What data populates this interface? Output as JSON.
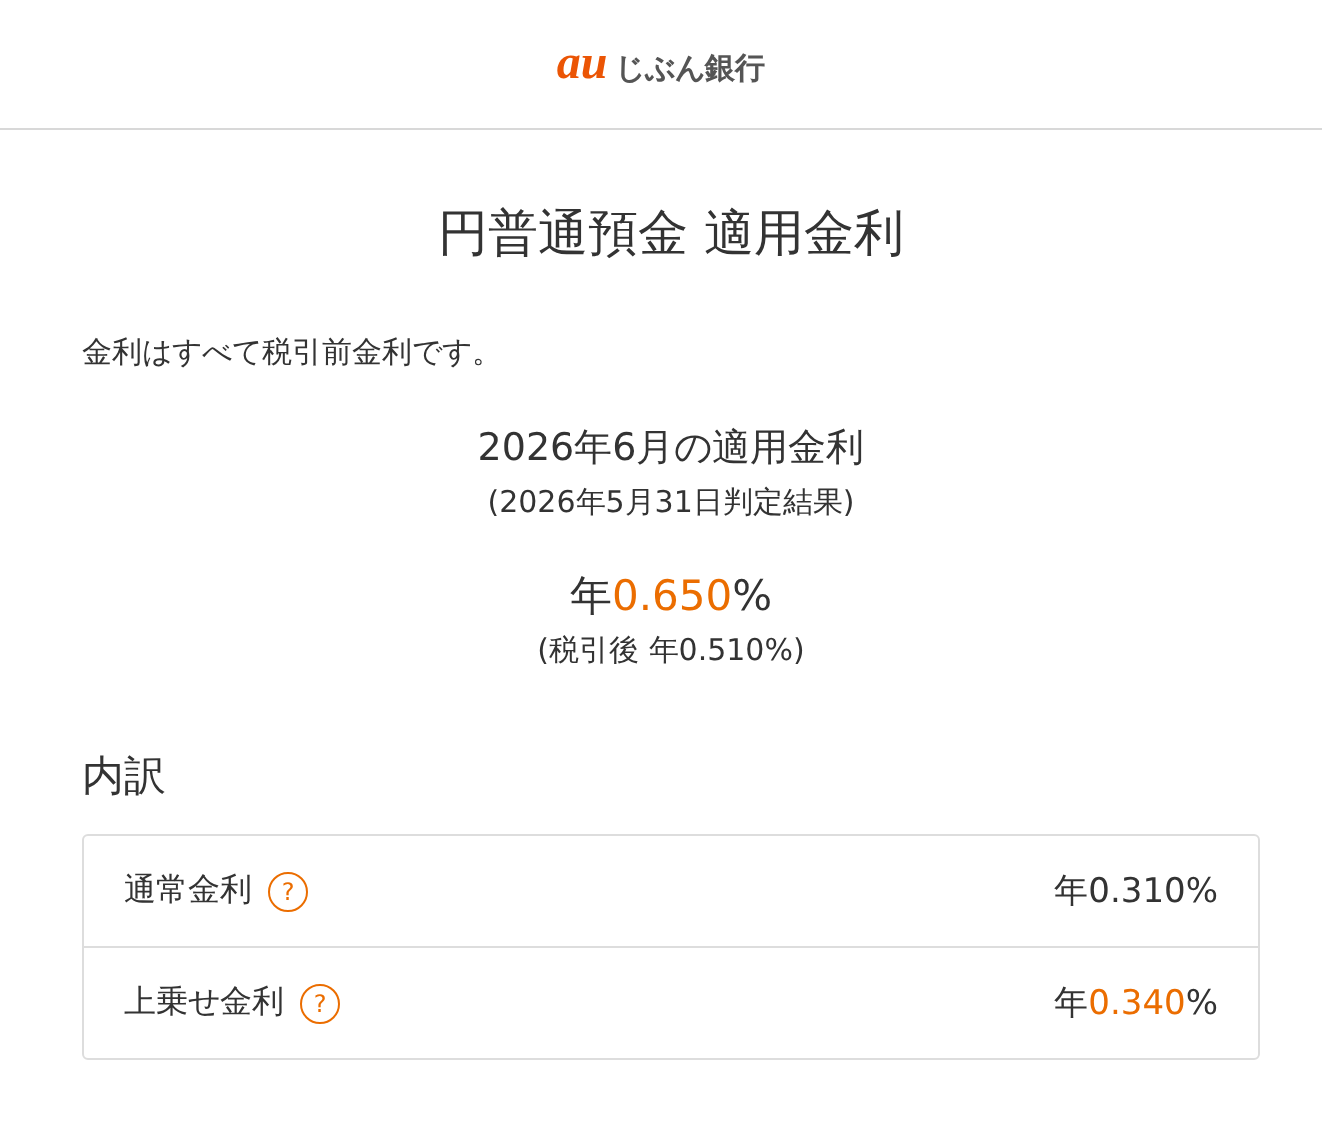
{
  "header": {
    "logo_mark": "au",
    "logo_text": "じぶん銀行"
  },
  "title": "円普通預金 適用金利",
  "note": "金利はすべて税引前金利です。",
  "summary": {
    "heading": "2026年6月の適用金利",
    "subheading": "(2026年5月31日判定結果)",
    "rate": {
      "prefix": "年",
      "value": "0.650",
      "suffix": "%",
      "highlight": true
    },
    "after_tax": "(税引後 年0.510%)"
  },
  "breakdown": {
    "heading": "内訳",
    "rows": [
      {
        "label": "通常金利",
        "help": "?",
        "rate": {
          "prefix": "年",
          "value": "0.310",
          "suffix": "%",
          "highlight": false
        }
      },
      {
        "label": "上乗せ金利",
        "help": "?",
        "rate": {
          "prefix": "年",
          "value": "0.340",
          "suffix": "%",
          "highlight": true
        }
      }
    ]
  }
}
